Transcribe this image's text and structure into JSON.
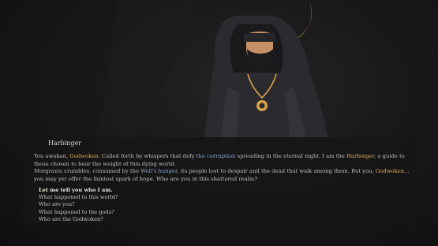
{
  "dialogue": {
    "speaker": "Harbinger",
    "line1": {
      "a": "You awaken, ",
      "b": "Godwoken",
      "c": ". Called forth by whispers that defy ",
      "d": "the corruption",
      "e": " spreading in the eternal night. I am the ",
      "f": "Harbinger",
      "g": ", a guide to those chosen to bear the weight of this dying world."
    },
    "line2": {
      "a": "Morgravia crumbles, consumed by the ",
      "b": "Well's hunger",
      "c": ", its people lost to despair and the dead that walk among them. But you, ",
      "d": "Godwoken",
      "e": "... you may yet offer the faintest spark of hope. Who are you in this shattered realm?"
    }
  },
  "choices": [
    "Let me tell you who I am.",
    "What happened to this world?",
    "Who are you?",
    "What happened to the gods?",
    "Who are the Godwoken?"
  ],
  "colors": {
    "highlight_gold": "#e0b45a",
    "highlight_blue": "#8fa6d8",
    "panel_bg": "#161616"
  }
}
